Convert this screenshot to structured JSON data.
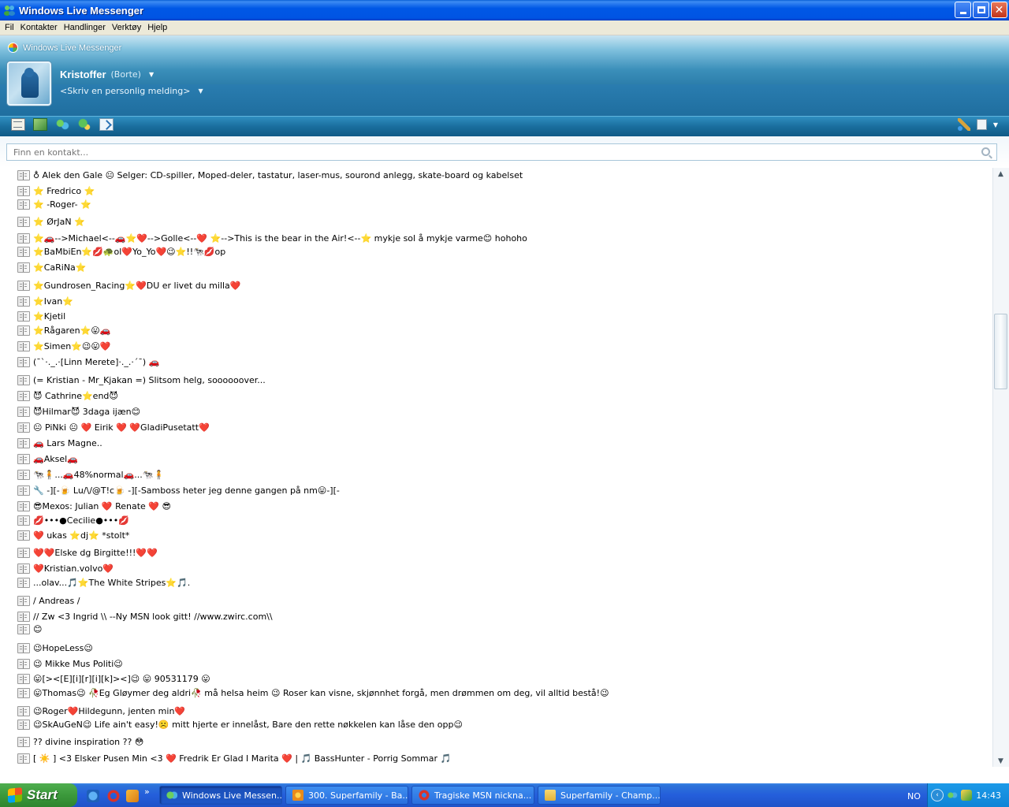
{
  "window": {
    "title": "Windows Live Messenger"
  },
  "menu": [
    "Fil",
    "Kontakter",
    "Handlinger",
    "Verktøy",
    "Hjelp"
  ],
  "brand": "Windows Live Messenger",
  "profile": {
    "name": "Kristoffer",
    "status": "(Borte)",
    "personal_message": "<Skriv en personlig melding>"
  },
  "search": {
    "placeholder": "Finn en kontakt..."
  },
  "contacts": [
    "♁ Alek den Gale 😐 Selger: CD-spiller, Moped-deler, tastatur, laser-mus, sourond anlegg, skate-board og kabelset",
    "⭐ Fredrico ⭐",
    "⭐ -Roger- ⭐",
    "⭐ ØrJaN ⭐",
    "⭐🚗-->Michael<--🚗⭐❤️-->Golle<--❤️ ⭐-->This is the bear in the Air!<--⭐ mykje sol å mykje varme😊 hohoho",
    "⭐BaMbiEn⭐💋🐢ol❤️Yo_Yo❤️😉⭐!!🐄💋op",
    "⭐CaRiNa⭐",
    "⭐Gundrosen_Racing⭐❤️DU er livet du milla❤️",
    "⭐Ivan⭐",
    "⭐Kjetil",
    "⭐Rågaren⭐😛🚗",
    "⭐Simen⭐😉😛❤️",
    "(¯`·._.·[Linn Merete]·._.·´¯) 🚗",
    "(= Kristian - Mr_Kjakan =) Slitsom helg, soooooover...",
    "😈 Cathrine⭐end😈",
    "😈Hilmar😈 3daga ijæn😊",
    "😐 PiNki 😐  ❤️ Eirik ❤️ ❤️GladiPusetatt❤️",
    "🚗 Lars Magne..",
    "🚗Aksel🚗",
    "🐄🧍...🚗48%normal🚗...🐄🧍",
    "🔧 -][-🍺 Lu/\\/@T!c🍺 -][-Samboss heter jeg denne gangen på nm😛-][-",
    "😎Mexos: Julian ❤️ Renate ❤️ 😎",
    "💋•••●Cecilie●•••💋",
    "❤️    ukas ⭐dj⭐ *stolt*",
    "❤️❤️Elske dg Birgitte!!!❤️❤️",
    "❤️Kristian.volvo❤️",
    "...olav...🎵⭐The White Stripes⭐🎵.",
    "/ Andreas /",
    "// Zw <3 Ingrid \\\\ --Ny MSN look gitt! //www.zwirc.com\\\\",
    "😊",
    "😉HopeLess😉",
    "😉 Mikke Mus Politi😉",
    "😛[><[E][i][r][i][k]><]😉  😛 90531179 😛",
    "😛Thomas😉 🥀Eg Gløymer deg aldri🥀 må helsa heim 😉 Roser kan visne, skjønnhet forgå, men drømmen om deg, vil alltid bestå!😉",
    "😉Roger❤️Hildegunn, jenten min❤️",
    "😉SkAuGeN😉 Life ain't easy!☹️ mitt hjerte er innelåst, Bare den rette nøkkelen kan låse den opp😉",
    "?? divine inspiration ?? 😳",
    "[ ☀️ ] <3 Elsker Pusen Min <3 ❤️ Fredrik Er Glad I Marita ❤️ | 🎵 BassHunter - Porrig Sommar 🎵"
  ],
  "taskbar": {
    "start": "Start",
    "tasks": [
      "Windows Live Messen...",
      "300. Superfamily - Ba...",
      "Tragiske MSN nickna...",
      "Superfamily - Champ..."
    ],
    "language": "NO",
    "clock": "14:43"
  }
}
